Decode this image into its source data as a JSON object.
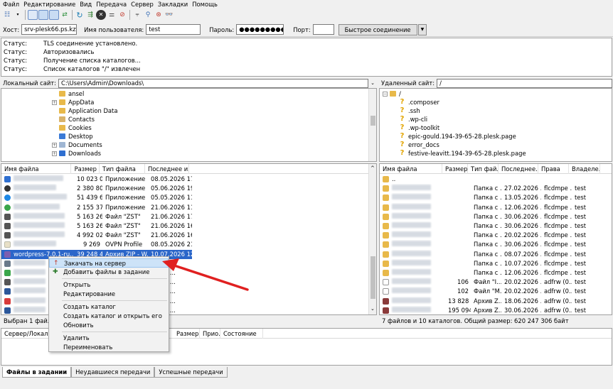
{
  "menu": [
    "Файл",
    "Редактирование",
    "Вид",
    "Передача",
    "Сервер",
    "Закладки",
    "Помощь"
  ],
  "quickconnect": {
    "host_label": "Хост:",
    "host_value": "srv-plesk66.ps.kz",
    "user_label": "Имя пользователя:",
    "user_value": "test",
    "pass_label": "Пароль:",
    "pass_value": "●●●●●●●●●",
    "port_label": "Порт:",
    "port_value": "",
    "connect_label": "Быстрое соединение"
  },
  "log": [
    {
      "k": "Статус:",
      "v": "TLS соединение установлено."
    },
    {
      "k": "Статус:",
      "v": "Авторизовались"
    },
    {
      "k": "Статус:",
      "v": "Получение списка каталогов..."
    },
    {
      "k": "Статус:",
      "v": "Список каталогов \"/\" извлечен"
    }
  ],
  "local": {
    "site_label": "Локальный сайт:",
    "path": "C:\\Users\\Admin\\Downloads\\",
    "tree": [
      "ansel",
      "AppData",
      "Application Data",
      "Contacts",
      "Cookies",
      "Desktop",
      "Documents",
      "Downloads"
    ],
    "headers": [
      "Имя файла",
      "Размер",
      "Тип файла",
      "Последнее из..."
    ],
    "rows": [
      {
        "size": "10 023 0...",
        "type": "Приложение",
        "date": "08.05.2026 17:..."
      },
      {
        "size": "2 380 800",
        "type": "Приложение",
        "date": "05.06.2026 19:..."
      },
      {
        "size": "51 439 6...",
        "type": "Приложение",
        "date": "05.05.2026 11:..."
      },
      {
        "size": "2 155 376",
        "type": "Приложение",
        "date": "21.06.2026 11:..."
      },
      {
        "size": "5 163 266",
        "type": "Файл \"ZST\"",
        "date": "21.06.2026 17:..."
      },
      {
        "size": "5 163 266",
        "type": "Файл \"ZST\"",
        "date": "21.06.2026 16:..."
      },
      {
        "size": "4 992 020",
        "type": "Файл \"ZST\"",
        "date": "21.06.2026 16:..."
      },
      {
        "size": "9 269",
        "type": "OVPN Profile",
        "date": "08.05.2026 21:..."
      },
      {
        "name": "wordpress-7.0.1-ru...",
        "size": "39 248 4...",
        "type": "Архив ZIP - W...",
        "date": "10.07.2026 12:..."
      },
      {
        "date": "26 16:..."
      },
      {
        "date": "26 19:..."
      },
      {
        "date": "26 19:..."
      },
      {
        "date": "26 15:..."
      },
      {
        "date": "26 14:..."
      },
      {
        "date": "26 16:..."
      }
    ],
    "status": "Выбран 1 файл. Р"
  },
  "remote": {
    "site_label": "Удаленный сайт:",
    "path": "/",
    "tree": [
      "/",
      ".composer",
      ".ssh",
      ".wp-cli",
      ".wp-toolkit",
      "epic-gould.194-39-65-28.plesk.page",
      "error_docs",
      "festive-leavitt.194-39-65-28.plesk.page"
    ],
    "headers": [
      "Имя файла",
      "Размер",
      "Тип фай...",
      "Последнее...",
      "Права",
      "Владеле..."
    ],
    "rows": [
      {
        "name": "..",
        "size": "",
        "type": "",
        "date": "",
        "perm": "",
        "owner": ""
      },
      {
        "size": "",
        "type": "Папка с ...",
        "date": "27.02.2026 ...",
        "perm": "flcdmpe ...",
        "owner": "test"
      },
      {
        "size": "",
        "type": "Папка с ...",
        "date": "13.05.2026 ...",
        "perm": "flcdmpe ...",
        "owner": "test"
      },
      {
        "size": "",
        "type": "Папка с ...",
        "date": "12.06.2026 ...",
        "perm": "flcdmpe ...",
        "owner": "test"
      },
      {
        "size": "",
        "type": "Папка с ...",
        "date": "30.06.2026 ...",
        "perm": "flcdmpe ...",
        "owner": "test"
      },
      {
        "size": "",
        "type": "Папка с ...",
        "date": "30.06.2026 ...",
        "perm": "flcdmpe ...",
        "owner": "test"
      },
      {
        "size": "",
        "type": "Папка с ...",
        "date": "20.02.2026 ...",
        "perm": "flcdmpe ...",
        "owner": "test"
      },
      {
        "size": "",
        "type": "Папка с ...",
        "date": "30.06.2026 ...",
        "perm": "flcdmpe ...",
        "owner": "test"
      },
      {
        "size": "",
        "type": "Папка с ...",
        "date": "08.07.2026 ...",
        "perm": "flcdmpe ...",
        "owner": "test"
      },
      {
        "size": "",
        "type": "Папка с ...",
        "date": "10.07.2026 ...",
        "perm": "flcdmpe ...",
        "owner": "test"
      },
      {
        "size": "",
        "type": "Папка с ...",
        "date": "12.06.2026 ...",
        "perm": "flcdmpe ...",
        "owner": "test"
      },
      {
        "size": "106",
        "type": "Файл \"I...",
        "date": "20.02.2026 ...",
        "perm": "adfrw (0...",
        "owner": "test"
      },
      {
        "size": "102",
        "type": "Файл \"M...",
        "date": "20.02.2026 ...",
        "perm": "adfrw (0...",
        "owner": "test"
      },
      {
        "size": "13 828",
        "type": "Архив Z...",
        "date": "18.06.2026 ...",
        "perm": "adfrw (0...",
        "owner": "test"
      },
      {
        "size": "195 094",
        "type": "Архив Z...",
        "date": "30.06.2026 ...",
        "perm": "adfrw (0...",
        "owner": "test"
      }
    ],
    "status": "7 файлов и 10 каталогов. Общий размер: 620 247 306 байт"
  },
  "context_menu": [
    "Закачать на сервер",
    "Добавить файлы в задание",
    "Открыть",
    "Редактирование",
    "Создать каталог",
    "Создать каталог и открыть его",
    "Обновить",
    "Удалить",
    "Переименовать"
  ],
  "queue": {
    "headers": [
      "Сервер/Локальн...",
      "Размер",
      "Прио...",
      "Состояние"
    ]
  },
  "tabs": [
    "Файлы в задании",
    "Неудавшиеся передачи",
    "Успешные передачи"
  ],
  "colors": {
    "selection": "#2b66c9",
    "arrow": "#e02020",
    "folder": "#e8b94a"
  }
}
